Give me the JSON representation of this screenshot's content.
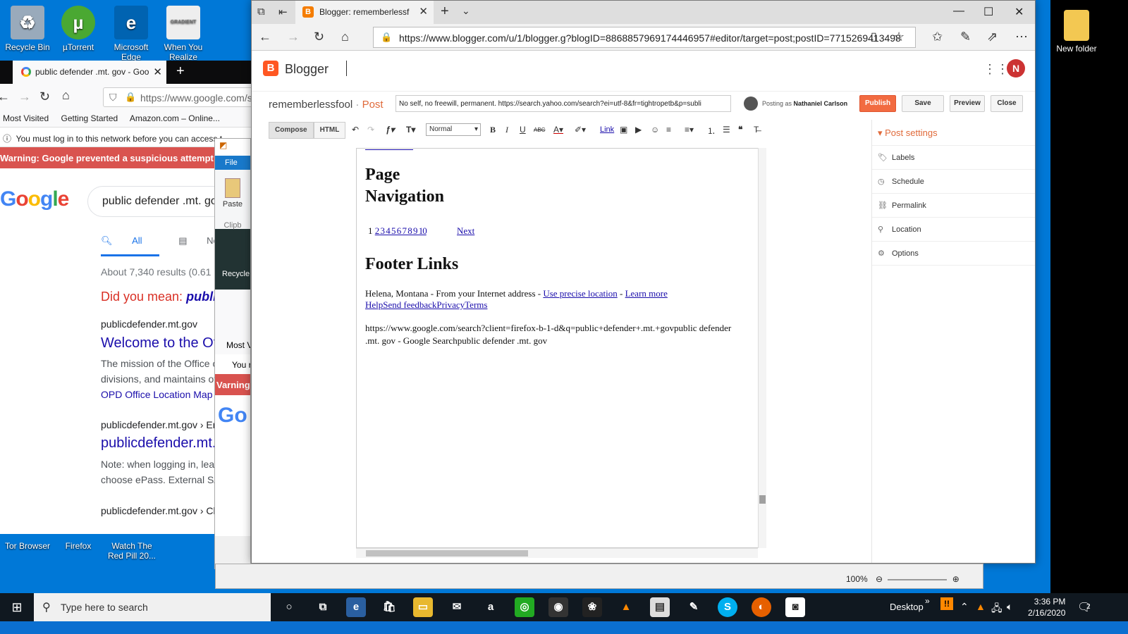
{
  "desktop": {
    "icons_left": [
      {
        "label": "Recycle Bin",
        "glyph": "recycle-icon"
      },
      {
        "label": "µTorrent",
        "glyph": "utorrent-icon"
      },
      {
        "label": "Microsoft Edge",
        "glyph": "edge-icon"
      },
      {
        "label": "When You Realize",
        "glyph": "gradient-icon"
      }
    ],
    "icons_bottom": [
      {
        "label": "Tor Browser"
      },
      {
        "label": "Firefox"
      },
      {
        "label": "Watch The Red Pill 20..."
      }
    ],
    "icon_right": {
      "label": "New folder"
    },
    "thumb_badge": "GRADIENT"
  },
  "firefox": {
    "tab_title": "public defender .mt. gov - Goo",
    "url": "https://www.google.com/s",
    "bookmarks": [
      "Most Visited",
      "Getting Started",
      "Amazon.com – Online..."
    ],
    "notice": "You must log in to this network before you can access t",
    "warning": "Warning: Google prevented a suspicious attempt to",
    "search_query": "public defender .mt. go",
    "search_tabs": [
      "All",
      "News"
    ],
    "results_count": "About 7,340 results (0.61",
    "did_you_mean_prefix": "Did you mean:",
    "did_you_mean_term": "publi",
    "results": [
      {
        "cite": "publicdefender.mt.gov",
        "title": "Welcome to the Of",
        "snippet1": "The mission of the Office o",
        "snippet2": "divisions, and maintains of",
        "sitelink": "OPD Office Location Map"
      },
      {
        "cite": "publicdefender.mt.gov › Er",
        "title": "publicdefender.mt.",
        "snippet1": "Note: when logging in, leav",
        "snippet2": "choose ePass. External SA"
      },
      {
        "cite": "publicdefender.mt.gov › Cl"
      }
    ]
  },
  "paint": {
    "file_tab": "File",
    "paste_label": "Paste",
    "clipboard_label": "Clipb",
    "recycle_label": "Recycle",
    "most_visited": "Most V",
    "notice": "You r",
    "warning": "Varning"
  },
  "edge": {
    "tab_title": "Blogger: rememberlessf",
    "url": "https://www.blogger.com/u/1/blogger.g?blogID=8868857969174446957#editor/target=post;postID=7715269413498"
  },
  "blogger": {
    "app_name": "Blogger",
    "avatar_letter": "N",
    "blog_name": "rememberlessfool",
    "post_type": "Post",
    "post_title": "No self, no freewill, permanent. https://search.yahoo.com/search?ei=utf-8&fr=tightropetb&p=subli",
    "posting_as_prefix": "Posting as",
    "posting_as_name": "Nathaniel Carlson",
    "buttons": {
      "publish": "Publish",
      "save": "Save",
      "preview": "Preview",
      "close": "Close"
    },
    "modes": {
      "compose": "Compose",
      "html": "HTML"
    },
    "format_select": "Normal",
    "link_label": "Link",
    "editor": {
      "h_page_nav_1": "Page",
      "h_page_nav_2": "Navigation",
      "pager_current": "1",
      "pager_links": "2 3 4 5 6 7 8 9 10",
      "pager_next": "Next",
      "h_footer": "Footer Links",
      "location_text": "Helena, Montana - From your Internet address - ",
      "use_precise": "Use precise location",
      "sep": " - ",
      "learn_more": "Learn more",
      "footer_links": "HelpSend feedbackPrivacyTerms",
      "url_line_1": "https://www.google.com/search?client=firefox-b-1-d&q=public+defender+.mt.+govpublic defender",
      "url_line_2": ".mt. gov - Google Searchpublic defender .mt. gov"
    },
    "sidebar": {
      "header": "Post settings",
      "items": [
        {
          "label": "Labels"
        },
        {
          "label": "Schedule"
        },
        {
          "label": "Permalink"
        },
        {
          "label": "Location"
        },
        {
          "label": "Options"
        }
      ]
    }
  },
  "zoom": {
    "value": "100%"
  },
  "taskbar": {
    "search_placeholder": "Type here to search",
    "desktop_label": "Desktop",
    "time": "3:36 PM",
    "date": "2/16/2020",
    "notif_count": "2"
  }
}
